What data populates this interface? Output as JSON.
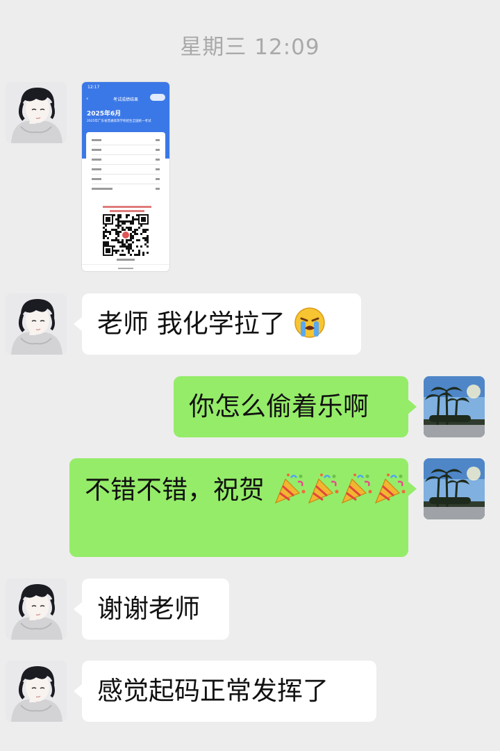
{
  "chat": {
    "timestamp": "星期三 12:09",
    "messages": [
      {
        "side": "left",
        "type": "image",
        "avatar": "anime-boy-avatar"
      },
      {
        "side": "left",
        "type": "text",
        "text": "老师 我化学拉了",
        "emoji": "loudly-crying-face"
      },
      {
        "side": "right",
        "type": "text",
        "text": "你怎么偷着乐啊",
        "avatar": "palm-trees-avatar"
      },
      {
        "side": "right",
        "type": "text",
        "text": "不错不错，祝贺",
        "emoji": "party-popper",
        "emoji_count": 4
      },
      {
        "side": "left",
        "type": "text",
        "text": "谢谢老师"
      },
      {
        "side": "left",
        "type": "text",
        "text": "感觉起码正常发挥了"
      }
    ]
  },
  "score_screenshot": {
    "status_time": "12:17",
    "page_title": "考试成绩结果",
    "heading": "2025年6月",
    "subtitle": "2025年广东省普通高等学校招生全国统一考试"
  },
  "colors": {
    "background": "#ededed",
    "incoming_bubble": "#ffffff",
    "outgoing_bubble": "#95ec69",
    "timestamp": "#a9a9a9"
  }
}
